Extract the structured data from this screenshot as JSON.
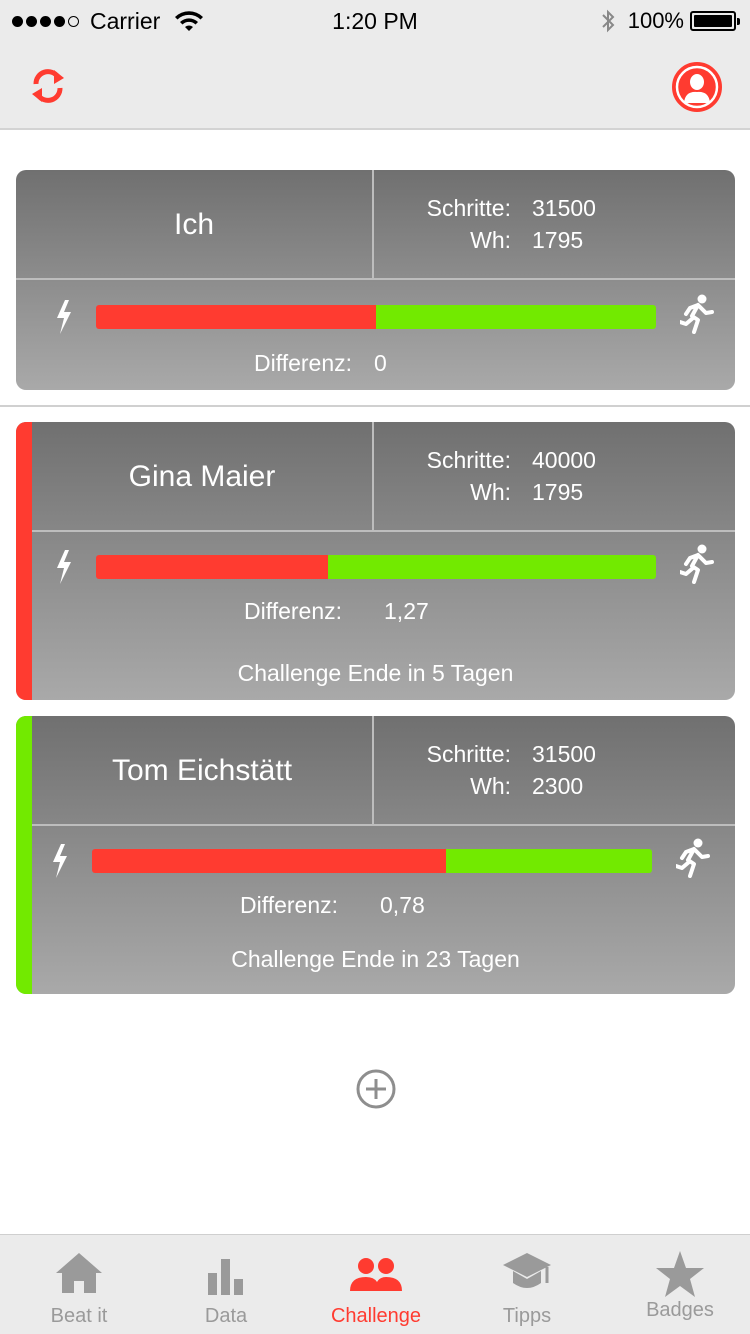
{
  "status_bar": {
    "carrier": "Carrier",
    "time": "1:20 PM",
    "battery": "100%"
  },
  "cards": [
    {
      "name": "Ich",
      "steps_label": "Schritte:",
      "steps": "31500",
      "wh_label": "Wh:",
      "wh": "1795",
      "ratio_red": 0.5,
      "diff_label": "Differenz:",
      "diff": "0"
    },
    {
      "name": "Gina Maier",
      "steps_label": "Schritte:",
      "steps": "40000",
      "wh_label": "Wh:",
      "wh": "1795",
      "ratio_red": 0.41,
      "diff_label": "Differenz:",
      "diff": "1,27",
      "ende": "Challenge Ende in 5 Tagen",
      "stripe_color": "#ff3b30"
    },
    {
      "name": "Tom Eichstätt",
      "steps_label": "Schritte:",
      "steps": "31500",
      "wh_label": "Wh:",
      "wh": "2300",
      "ratio_red": 0.63,
      "diff_label": "Differenz:",
      "diff": "0,78",
      "ende": "Challenge Ende in 23 Tagen",
      "stripe_color": "#72ea00"
    }
  ],
  "tabs": [
    {
      "label": "Beat it",
      "icon": "home-icon"
    },
    {
      "label": "Data",
      "icon": "bar-chart-icon"
    },
    {
      "label": "Challenge",
      "icon": "group-icon",
      "active": true
    },
    {
      "label": "Tipps",
      "icon": "graduation-cap-icon"
    },
    {
      "label": "Badges",
      "icon": "star-icon"
    }
  ],
  "colors": {
    "accent": "#ff3b30",
    "green": "#72ea00",
    "inactive": "#9a9a9a"
  }
}
